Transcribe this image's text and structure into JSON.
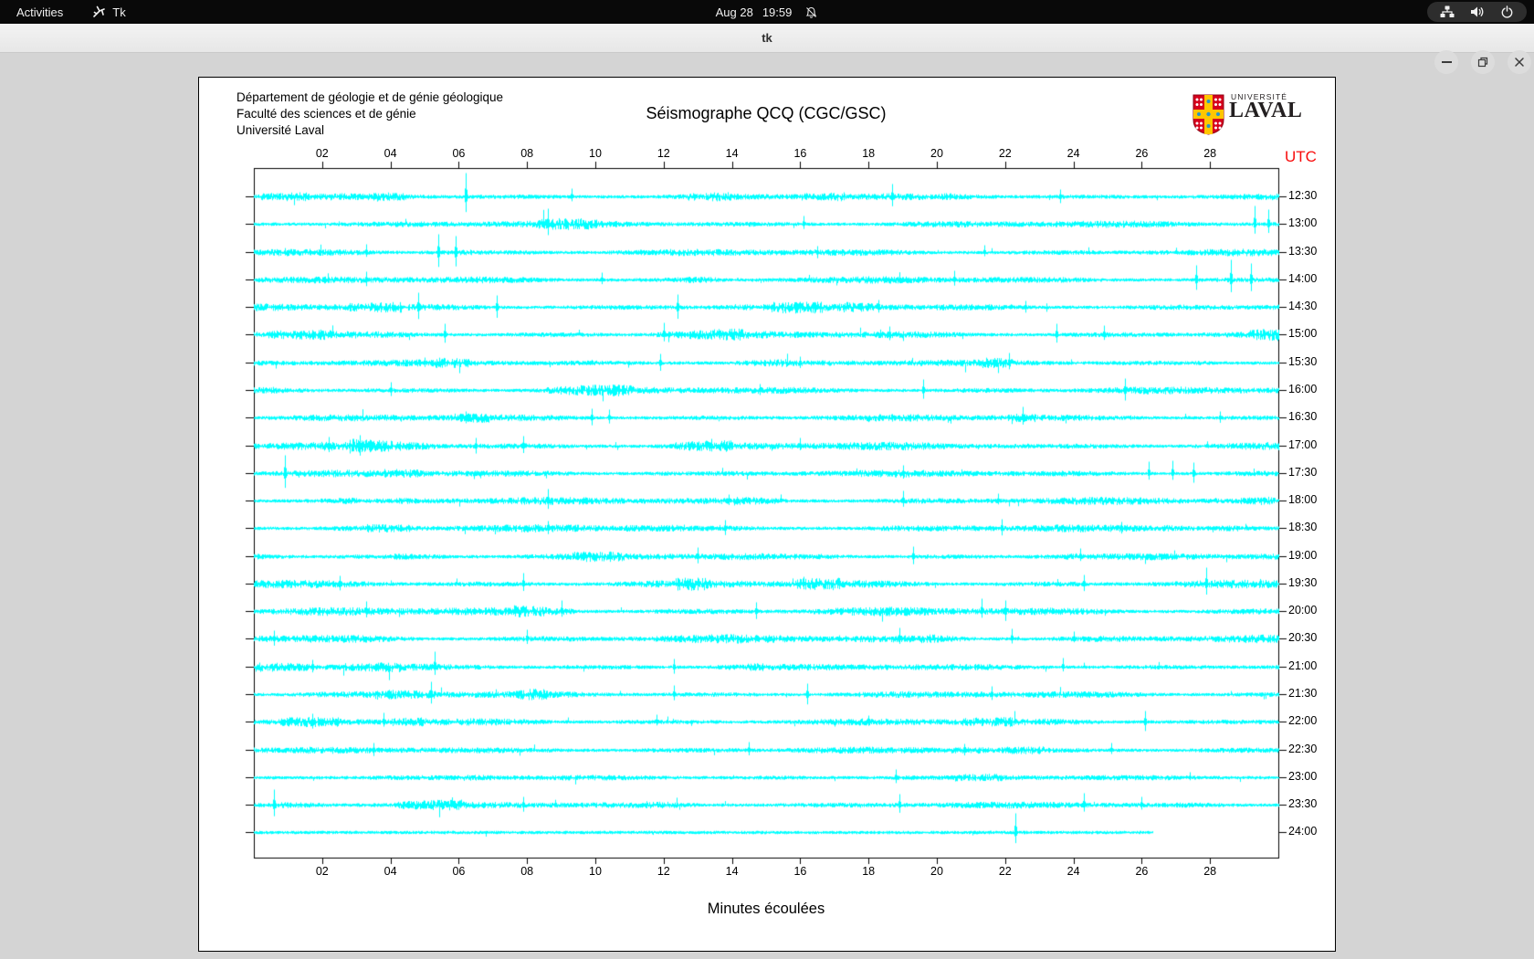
{
  "topbar": {
    "activities_label": "Activities",
    "app_label": "Tk",
    "date": "Aug 28",
    "time": "19:59",
    "status_icons": [
      "network-icon",
      "volume-icon",
      "power-icon"
    ],
    "notification_icon": "notifications-muted-icon"
  },
  "titlebar": {
    "title": "tk",
    "buttons": [
      "minimize",
      "maximize",
      "close"
    ]
  },
  "institution": {
    "lines": [
      "Département de géologie et de génie géologique",
      "Faculté des sciences et de génie",
      "Université Laval"
    ]
  },
  "logo": {
    "line1": "UNIVERSITÉ",
    "line2": "LAVAL",
    "colors": {
      "red": "#d6001c",
      "gold": "#ffc600",
      "blue": "#2796c9",
      "text": "#231f20"
    }
  },
  "chart_data": {
    "type": "line",
    "subtype": "helicorder-seismogram",
    "title": "Séismographe QCQ (CGC/GSC)",
    "xlabel": "Minutes écoulées",
    "right_axis_label": "UTC",
    "right_axis_color": "#f80c0c",
    "trace_color": "#00ffff",
    "x_range_minutes": [
      0,
      30
    ],
    "x_tick_labels": [
      "02",
      "04",
      "06",
      "08",
      "10",
      "12",
      "14",
      "16",
      "18",
      "20",
      "22",
      "24",
      "26",
      "28"
    ],
    "grid": false,
    "traces": [
      {
        "utc": "12:30",
        "seed": 101,
        "activity": 0.5,
        "end_minute": 30,
        "spikes": [
          [
            6.2,
            26
          ],
          [
            9.3,
            9
          ],
          [
            18.7,
            14
          ],
          [
            23.6,
            8
          ]
        ]
      },
      {
        "utc": "13:00",
        "seed": 102,
        "activity": 0.55,
        "end_minute": 30,
        "spikes": [
          [
            8.6,
            17
          ],
          [
            16.1,
            9
          ],
          [
            29.3,
            20
          ],
          [
            29.7,
            16
          ]
        ]
      },
      {
        "utc": "13:30",
        "seed": 103,
        "activity": 0.55,
        "end_minute": 30,
        "spikes": [
          [
            3.3,
            9
          ],
          [
            5.4,
            20
          ],
          [
            5.9,
            18
          ],
          [
            16.5,
            7
          ],
          [
            21.4,
            8
          ]
        ]
      },
      {
        "utc": "14:00",
        "seed": 104,
        "activity": 0.55,
        "end_minute": 30,
        "spikes": [
          [
            3.3,
            9
          ],
          [
            10.2,
            8
          ],
          [
            20.5,
            10
          ],
          [
            27.6,
            16
          ],
          [
            28.6,
            22
          ],
          [
            29.2,
            18
          ]
        ]
      },
      {
        "utc": "14:30",
        "seed": 105,
        "activity": 0.6,
        "end_minute": 30,
        "spikes": [
          [
            4.8,
            16
          ],
          [
            7.1,
            13
          ],
          [
            12.4,
            14
          ],
          [
            18.3,
            8
          ],
          [
            22.6,
            7
          ]
        ]
      },
      {
        "utc": "15:00",
        "seed": 106,
        "activity": 0.6,
        "end_minute": 30,
        "spikes": [
          [
            5.6,
            12
          ],
          [
            12.0,
            13
          ],
          [
            18.6,
            9
          ],
          [
            23.5,
            12
          ],
          [
            24.9,
            10
          ]
        ]
      },
      {
        "utc": "15:30",
        "seed": 107,
        "activity": 0.5,
        "end_minute": 30,
        "spikes": [
          [
            5.0,
            6
          ],
          [
            11.9,
            10
          ],
          [
            16.0,
            7
          ],
          [
            22.1,
            11
          ]
        ]
      },
      {
        "utc": "16:00",
        "seed": 108,
        "activity": 0.6,
        "end_minute": 30,
        "spikes": [
          [
            4.0,
            9
          ],
          [
            14.8,
            7
          ],
          [
            19.6,
            12
          ],
          [
            25.5,
            13
          ]
        ]
      },
      {
        "utc": "16:30",
        "seed": 109,
        "activity": 0.55,
        "end_minute": 30,
        "spikes": [
          [
            6.2,
            7
          ],
          [
            9.9,
            10
          ],
          [
            10.4,
            9
          ],
          [
            22.5,
            12
          ],
          [
            28.3,
            7
          ]
        ]
      },
      {
        "utc": "17:00",
        "seed": 110,
        "activity": 0.7,
        "end_minute": 30,
        "spikes": [
          [
            2.2,
            10
          ],
          [
            3.1,
            12
          ],
          [
            6.5,
            9
          ],
          [
            7.9,
            11
          ],
          [
            13.4,
            8
          ],
          [
            16.0,
            9
          ]
        ]
      },
      {
        "utc": "17:30",
        "seed": 111,
        "activity": 0.55,
        "end_minute": 30,
        "spikes": [
          [
            0.9,
            20
          ],
          [
            19.0,
            9
          ],
          [
            26.2,
            13
          ],
          [
            26.9,
            14
          ],
          [
            27.5,
            12
          ]
        ]
      },
      {
        "utc": "18:00",
        "seed": 112,
        "activity": 0.6,
        "end_minute": 30,
        "spikes": [
          [
            8.6,
            13
          ],
          [
            13.9,
            7
          ],
          [
            19.0,
            11
          ],
          [
            21.8,
            8
          ]
        ]
      },
      {
        "utc": "18:30",
        "seed": 113,
        "activity": 0.6,
        "end_minute": 30,
        "spikes": [
          [
            8.6,
            8
          ],
          [
            13.8,
            9
          ],
          [
            21.9,
            10
          ],
          [
            25.4,
            7
          ]
        ]
      },
      {
        "utc": "19:00",
        "seed": 114,
        "activity": 0.55,
        "end_minute": 30,
        "spikes": [
          [
            13.0,
            10
          ],
          [
            19.3,
            11
          ],
          [
            24.2,
            9
          ]
        ]
      },
      {
        "utc": "19:30",
        "seed": 115,
        "activity": 0.7,
        "end_minute": 30,
        "spikes": [
          [
            2.5,
            9
          ],
          [
            7.9,
            12
          ],
          [
            16.1,
            8
          ],
          [
            24.3,
            10
          ],
          [
            27.9,
            18
          ]
        ]
      },
      {
        "utc": "20:00",
        "seed": 116,
        "activity": 0.75,
        "end_minute": 30,
        "spikes": [
          [
            3.3,
            11
          ],
          [
            9.0,
            12
          ],
          [
            14.7,
            10
          ],
          [
            21.3,
            14
          ],
          [
            22.0,
            12
          ]
        ]
      },
      {
        "utc": "20:30",
        "seed": 117,
        "activity": 0.75,
        "end_minute": 30,
        "spikes": [
          [
            0.6,
            9
          ],
          [
            8.0,
            10
          ],
          [
            18.9,
            12
          ],
          [
            22.2,
            11
          ],
          [
            24.0,
            8
          ]
        ]
      },
      {
        "utc": "21:00",
        "seed": 118,
        "activity": 0.5,
        "end_minute": 30,
        "spikes": [
          [
            1.7,
            8
          ],
          [
            5.3,
            17
          ],
          [
            12.3,
            9
          ],
          [
            23.7,
            10
          ]
        ]
      },
      {
        "utc": "21:30",
        "seed": 119,
        "activity": 0.55,
        "end_minute": 30,
        "spikes": [
          [
            5.2,
            14
          ],
          [
            12.3,
            10
          ],
          [
            16.2,
            12
          ],
          [
            21.6,
            9
          ]
        ]
      },
      {
        "utc": "22:00",
        "seed": 120,
        "activity": 0.55,
        "end_minute": 30,
        "spikes": [
          [
            1.7,
            9
          ],
          [
            3.8,
            10
          ],
          [
            11.8,
            8
          ],
          [
            18.0,
            7
          ],
          [
            26.1,
            12
          ]
        ]
      },
      {
        "utc": "22:30",
        "seed": 121,
        "activity": 0.5,
        "end_minute": 30,
        "spikes": [
          [
            3.5,
            8
          ],
          [
            14.5,
            9
          ],
          [
            20.8,
            7
          ],
          [
            25.1,
            8
          ]
        ]
      },
      {
        "utc": "23:00",
        "seed": 122,
        "activity": 0.35,
        "end_minute": 30,
        "spikes": [
          [
            18.8,
            9
          ],
          [
            27.4,
            6
          ]
        ]
      },
      {
        "utc": "23:30",
        "seed": 123,
        "activity": 0.5,
        "end_minute": 30,
        "spikes": [
          [
            0.6,
            17
          ],
          [
            7.9,
            9
          ],
          [
            18.9,
            12
          ],
          [
            24.3,
            13
          ],
          [
            26.0,
            9
          ]
        ]
      },
      {
        "utc": "24:00",
        "seed": 124,
        "activity": 0.1,
        "end_minute": 26.3,
        "spikes": [
          [
            22.3,
            21
          ]
        ]
      }
    ]
  }
}
